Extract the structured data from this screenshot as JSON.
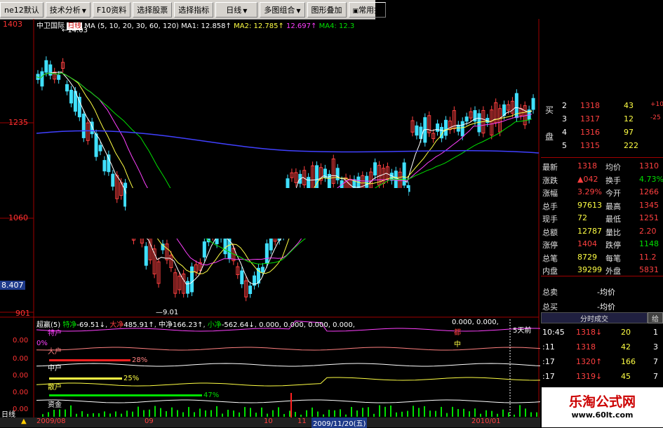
{
  "toolbar": {
    "items": [
      "ne12默认",
      "技术分析",
      "F10资料",
      "选择股票",
      "选择指标",
      "日线",
      "多图组合",
      "图形叠加",
      "常用指"
    ]
  },
  "main_chart": {
    "stock_name": "中卫国际",
    "period": "日线",
    "ma_label": "MA (5, 10, 20, 30, 60, 120)",
    "ma1": "MA1: 12.858↑",
    "ma2": "MA2: 12.785↑",
    "ma3": "12.697↑",
    "ma4": "MA4: 12.3",
    "high_mark": "14.03",
    "low_mark": "9.01",
    "y_labels": [
      "1403",
      "1235",
      "1060",
      "8.407",
      "901"
    ]
  },
  "sub_chart": {
    "indicator": "超赢(5)",
    "legend": [
      {
        "label": "特净",
        "value": "-69.51↓",
        "color": "#ffffff"
      },
      {
        "label": "大净",
        "value": "485.91↑",
        "color": "#ff4040"
      },
      {
        "label": "中净",
        "value": "166.23↑",
        "color": "#e0e0e0"
      },
      {
        "label": "小净",
        "value": "-562.64↓",
        "color": "#00e000"
      }
    ],
    "zeros": "0.000, 0.000, 0.000, 0.000,",
    "zeros_right": "0.000, 0.000,",
    "lines": [
      "特户",
      "大户",
      "中户",
      "散户",
      "资金"
    ],
    "pct_labels": [
      "0%",
      "28%",
      "25%",
      "47%"
    ],
    "y_labels": [
      "0.00",
      "0.00",
      "0.00",
      "0.00",
      "0.00"
    ],
    "annotation_5days": "5天前",
    "annotation_red": "都",
    "annotation_yellow": "中",
    "dates": [
      "2009/08",
      "09",
      "10",
      "11",
      "2009/11/20(五)",
      "2010/01"
    ]
  },
  "bottom_tab": "日线",
  "quote_panel": {
    "buy_label_1": "买",
    "buy_label_2": "盘",
    "bids": [
      {
        "lvl": "2",
        "price": "1318",
        "vol": "43",
        "chg": "+10"
      },
      {
        "lvl": "3",
        "price": "1317",
        "vol": "12",
        "chg": "-25"
      },
      {
        "lvl": "4",
        "price": "1316",
        "vol": "97",
        "chg": ""
      },
      {
        "lvl": "5",
        "price": "1315",
        "vol": "222",
        "chg": ""
      }
    ],
    "stats": [
      {
        "k": "最新",
        "v": "1318",
        "k2": "均价",
        "v2": "1310"
      },
      {
        "k": "涨跌",
        "v": "▲042",
        "k2": "换手",
        "v2": "4.73%"
      },
      {
        "k": "涨幅",
        "v": "3.29%",
        "k2": "今开",
        "v2": "1266"
      },
      {
        "k": "总手",
        "v": "97613",
        "k2": "最高",
        "v2": "1345"
      },
      {
        "k": "现手",
        "v": "72",
        "k2": "最低",
        "v2": "1251"
      },
      {
        "k": "总额",
        "v": "12787",
        "k2": "量比",
        "v2": "2.20"
      },
      {
        "k": "涨停",
        "v": "1404",
        "k2": "跌停",
        "v2": "1148"
      },
      {
        "k": "总笔",
        "v": "8729",
        "k2": "每笔",
        "v2": "11.2"
      },
      {
        "k": "内盘",
        "v": "39299",
        "k2": "外盘",
        "v2": "5831"
      }
    ],
    "total_sell": {
      "k": "总卖",
      "v": "-均价"
    },
    "total_buy": {
      "k": "总买",
      "v": "-均价"
    },
    "tick_header": "分时成交",
    "tick_btn": "给",
    "ticks": [
      {
        "t": "10:45",
        "p": "1318↓",
        "v": "20",
        "n": "1"
      },
      {
        "t": ":11",
        "p": "1318",
        "v": "42",
        "n": "3"
      },
      {
        "t": ":17",
        "p": "1320↑",
        "v": "166",
        "n": "7"
      },
      {
        "t": ":17",
        "p": "1319↓",
        "v": "45",
        "n": "7"
      }
    ]
  },
  "watermark": {
    "title": "乐淘公式网",
    "url": "www.60lt.com"
  },
  "colors": {
    "up": "#ff4040",
    "down": "#40e0ff",
    "ma5": "#ffffff",
    "ma10": "#ffff44",
    "ma20": "#ff40ff",
    "ma60": "#00e000",
    "ma120": "#4040ff",
    "grid": "#a00000"
  }
}
